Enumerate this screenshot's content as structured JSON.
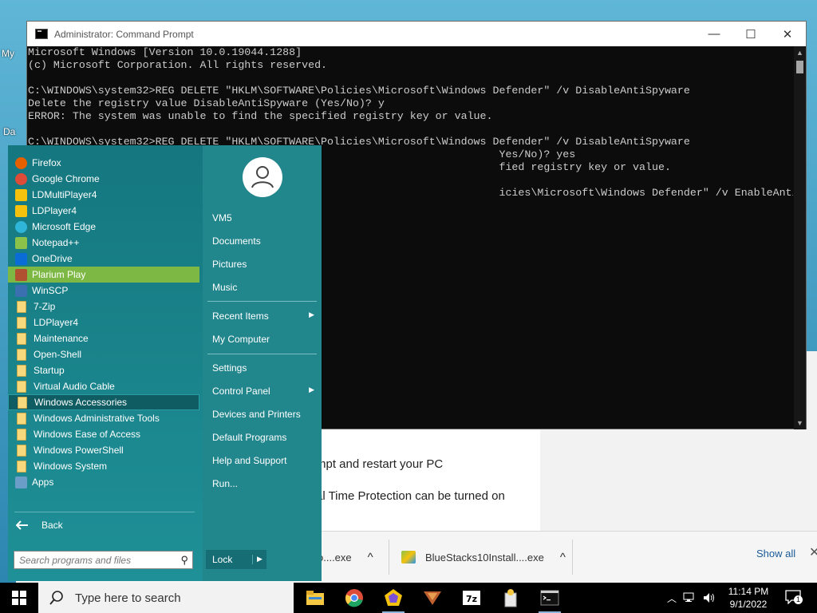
{
  "desktop": {
    "label_my": "My",
    "label_da": "Da"
  },
  "cmd": {
    "title": "Administrator: Command Prompt",
    "lines": [
      "Microsoft Windows [Version 10.0.19044.1288]",
      "(c) Microsoft Corporation. All rights reserved.",
      "",
      "C:\\WINDOWS\\system32>REG DELETE \"HKLM\\SOFTWARE\\Policies\\Microsoft\\Windows Defender\" /v DisableAntiSpyware",
      "Delete the registry value DisableAntiSpyware (Yes/No)? y",
      "ERROR: The system was unable to find the specified registry key or value.",
      "",
      "C:\\WINDOWS\\system32>REG DELETE \"HKLM\\SOFTWARE\\Policies\\Microsoft\\Windows Defender\" /v DisableAntiSpyware",
      "                                                                          Yes/No)? yes",
      "                                                                          fied registry key or value.",
      "",
      "                                                                          icies\\Microsoft\\Windows Defender\" /v EnableAntiSpyware"
    ],
    "minimize": "—",
    "maximize": "☐",
    "close": "✕"
  },
  "browser": {
    "text1": "mpt and restart your PC",
    "text2": "al Time Protection can be turned on",
    "downloads": [
      {
        "name": "o....exe",
        "arrow": "^"
      },
      {
        "name": "BlueStacks10Install....exe",
        "arrow": "^"
      }
    ],
    "show_all": "Show all",
    "close": "✕"
  },
  "start_menu": {
    "programs": [
      {
        "label": "Firefox",
        "icon": "firefox-icon",
        "color": "#e66000"
      },
      {
        "label": "Google Chrome",
        "icon": "chrome-icon",
        "color": "#dd4b39"
      },
      {
        "label": "LDMultiPlayer4",
        "icon": "ldmultiplayer-icon",
        "color": "#f4c20d"
      },
      {
        "label": "LDPlayer4",
        "icon": "ldplayer-icon",
        "color": "#f4c20d"
      },
      {
        "label": "Microsoft Edge",
        "icon": "edge-icon",
        "color": "#2fb5d8"
      },
      {
        "label": "Notepad++",
        "icon": "notepadpp-icon",
        "color": "#8bc34a"
      },
      {
        "label": "OneDrive",
        "icon": "onedrive-icon",
        "color": "#0a6cd6"
      },
      {
        "label": "Plarium Play",
        "icon": "plarium-icon",
        "color": "#b05030"
      },
      {
        "label": "WinSCP",
        "icon": "winscp-icon",
        "color": "#3a6fb0"
      },
      {
        "label": "7-Zip",
        "icon": "folder-icon",
        "color": "folder"
      },
      {
        "label": "LDPlayer4",
        "icon": "folder-icon",
        "color": "folder"
      },
      {
        "label": "Maintenance",
        "icon": "folder-icon",
        "color": "folder"
      },
      {
        "label": "Open-Shell",
        "icon": "folder-icon",
        "color": "folder"
      },
      {
        "label": "Startup",
        "icon": "folder-icon",
        "color": "folder"
      },
      {
        "label": "Virtual Audio Cable",
        "icon": "folder-icon",
        "color": "folder"
      },
      {
        "label": "Windows Accessories",
        "icon": "folder-icon",
        "color": "folder"
      },
      {
        "label": "Windows Administrative Tools",
        "icon": "folder-icon",
        "color": "folder"
      },
      {
        "label": "Windows Ease of Access",
        "icon": "folder-icon",
        "color": "folder"
      },
      {
        "label": "Windows PowerShell",
        "icon": "folder-icon",
        "color": "folder"
      },
      {
        "label": "Windows System",
        "icon": "folder-icon",
        "color": "folder"
      },
      {
        "label": "Apps",
        "icon": "apps-icon",
        "color": "#6a9ec8"
      }
    ],
    "selected_item": "Plarium Play",
    "hovered_item": "Windows Accessories",
    "back": "Back",
    "search_placeholder": "Search programs and files",
    "right_items": [
      {
        "label": "VM5",
        "arrow": ""
      },
      {
        "label": "Documents",
        "arrow": ""
      },
      {
        "label": "Pictures",
        "arrow": ""
      },
      {
        "label": "Music",
        "arrow": ""
      },
      {
        "label": "Recent Items",
        "arrow": "▶"
      },
      {
        "label": "My Computer",
        "arrow": ""
      },
      {
        "label": "Settings",
        "arrow": ""
      },
      {
        "label": "Control Panel",
        "arrow": "▶"
      },
      {
        "label": "Devices and Printers",
        "arrow": ""
      },
      {
        "label": "Default Programs",
        "arrow": ""
      },
      {
        "label": "Help and Support",
        "arrow": ""
      },
      {
        "label": "Run...",
        "arrow": ""
      }
    ],
    "lock": "Lock",
    "lock_arrow": "▶"
  },
  "taskbar": {
    "search_placeholder": "Type here to search",
    "time": "11:14 PM",
    "date": "9/1/2022",
    "notification_count": "1"
  }
}
